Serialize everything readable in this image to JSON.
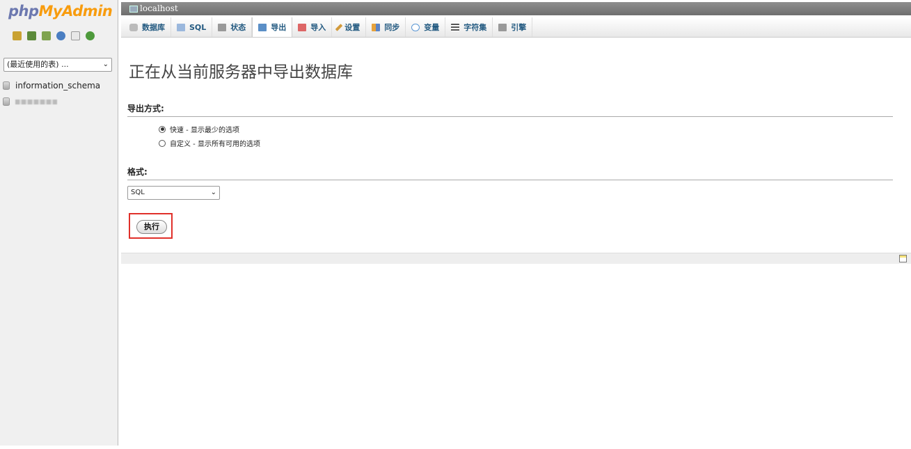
{
  "nav": {
    "logo_php": "php",
    "logo_my": "MyAdmin",
    "icons": [
      {
        "name": "home-icon",
        "color": "#c9a233"
      },
      {
        "name": "logout-icon",
        "color": "#5c8a3a"
      },
      {
        "name": "sql-query-icon",
        "color": "#7fa34f"
      },
      {
        "name": "help-icon",
        "color": "#4a7ec2"
      },
      {
        "name": "docs-icon",
        "color": "#b8b8b8"
      },
      {
        "name": "reload-icon",
        "color": "#4e9a3c"
      }
    ],
    "db_select": "(最近使用的表) ...",
    "databases": [
      "information_schema"
    ]
  },
  "serverbar": {
    "server": "localhost"
  },
  "tabs": [
    {
      "label": "数据库",
      "icon": "database-icon",
      "color": "#aaa"
    },
    {
      "label": "SQL",
      "icon": "sql-icon",
      "color": "#7aa0d0"
    },
    {
      "label": "状态",
      "icon": "status-icon",
      "color": "#999"
    },
    {
      "label": "导出",
      "icon": "export-icon",
      "color": "#5b8fc7"
    },
    {
      "label": "导入",
      "icon": "import-icon",
      "color": "#c55"
    },
    {
      "label": "设置",
      "icon": "settings-icon",
      "color": "#d29a3a"
    },
    {
      "label": "同步",
      "icon": "sync-icon",
      "color": "#6a8fd0"
    },
    {
      "label": "变量",
      "icon": "variables-icon",
      "color": "#5b97d4"
    },
    {
      "label": "字符集",
      "icon": "charset-icon",
      "color": "#666"
    },
    {
      "label": "引擎",
      "icon": "engine-icon",
      "color": "#888"
    }
  ],
  "main": {
    "title": "正在从当前服务器中导出数据库",
    "export_method_heading": "导出方式:",
    "method_quick": "快速 - 显示最少的选项",
    "method_custom": "自定义 - 显示所有可用的选项",
    "format_heading": "格式:",
    "format_value": "SQL",
    "go_label": "执行"
  }
}
